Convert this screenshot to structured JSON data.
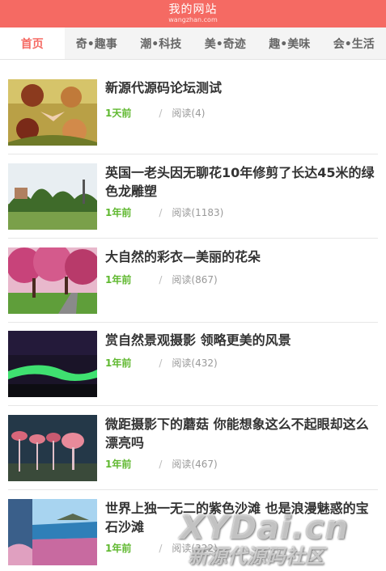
{
  "site": {
    "title": "我的网站",
    "subtitle": "wangzhan.com"
  },
  "nav": [
    {
      "label": "首页",
      "active": true
    },
    {
      "label": "奇•趣事"
    },
    {
      "label": "潮•科技"
    },
    {
      "label": "美•奇迹"
    },
    {
      "label": "趣•美味"
    },
    {
      "label": "会•生活"
    }
  ],
  "articles": [
    {
      "title": "新源代源码论坛测试",
      "time": "1天前",
      "reads": "阅读(4)"
    },
    {
      "title": "英国一老头因无聊花10年修剪了长达45米的绿色龙雕塑",
      "time": "1年前",
      "reads": "阅读(1183)"
    },
    {
      "title": "大自然的彩衣—美丽的花朵",
      "time": "1年前",
      "reads": "阅读(867)"
    },
    {
      "title": "赏自然景观摄影 领略更美的风景",
      "time": "1年前",
      "reads": "阅读(432)"
    },
    {
      "title": "微距摄影下的蘑菇 你能想象这么不起眼却这么漂亮吗",
      "time": "1年前",
      "reads": "阅读(467)"
    },
    {
      "title": "世界上独一无二的紫色沙滩 也是浪漫魅惑的宝石沙滩",
      "time": "1年前",
      "reads": "阅读(322)"
    }
  ],
  "meta_separator": "/",
  "watermark": {
    "main": "XYDai.cn",
    "sub": "新源代源码社区"
  }
}
